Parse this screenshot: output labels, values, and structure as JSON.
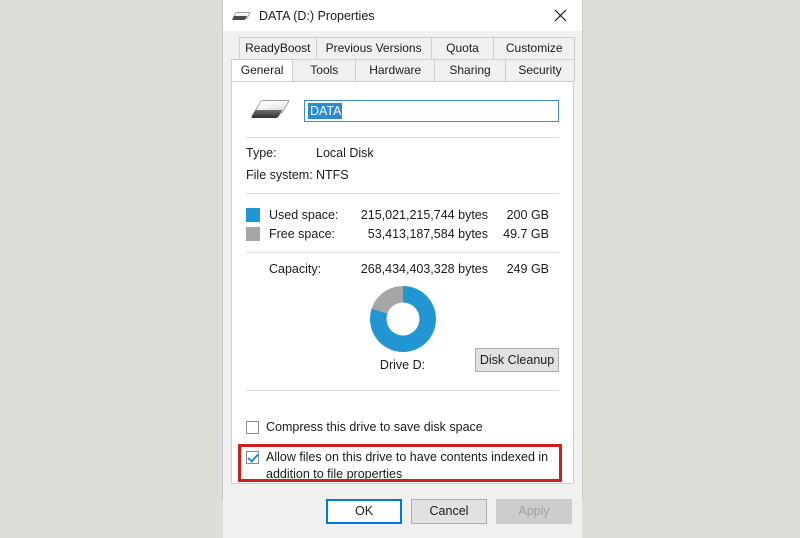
{
  "window": {
    "title": "DATA (D:) Properties",
    "icon": "hard-drive-icon",
    "close_label": "✕"
  },
  "tabs": {
    "row1": [
      {
        "label": "ReadyBoost",
        "active": false
      },
      {
        "label": "Previous Versions",
        "active": false
      },
      {
        "label": "Quota",
        "active": false
      },
      {
        "label": "Customize",
        "active": false
      }
    ],
    "row2": [
      {
        "label": "General",
        "active": true
      },
      {
        "label": "Tools",
        "active": false
      },
      {
        "label": "Hardware",
        "active": false
      },
      {
        "label": "Sharing",
        "active": false
      },
      {
        "label": "Security",
        "active": false
      }
    ]
  },
  "general": {
    "volume_name": "DATA",
    "type_label": "Type:",
    "type_value": "Local Disk",
    "filesystem_label": "File system:",
    "filesystem_value": "NTFS",
    "used": {
      "label": "Used space:",
      "bytes": "215,021,215,744 bytes",
      "size": "200 GB",
      "color": "#2196d3"
    },
    "free": {
      "label": "Free space:",
      "bytes": "53,413,187,584 bytes",
      "size": "49.7 GB",
      "color": "#a6a6a6"
    },
    "capacity": {
      "label": "Capacity:",
      "bytes": "268,434,403,328 bytes",
      "size": "249 GB"
    },
    "drive_label": "Drive D:",
    "disk_cleanup_label": "Disk Cleanup",
    "compress_checkbox": {
      "label": "Compress this drive to save disk space",
      "checked": false
    },
    "index_checkbox": {
      "label": "Allow files on this drive to have contents indexed in addition to file properties",
      "checked": true,
      "highlighted": true,
      "highlight_color": "#cc1f1f"
    }
  },
  "footer": {
    "ok_label": "OK",
    "cancel_label": "Cancel",
    "apply_label": "Apply",
    "apply_enabled": false
  },
  "chart_data": {
    "type": "pie",
    "title": "Drive D:",
    "categories": [
      "Used space",
      "Free space"
    ],
    "values": [
      215021215744,
      53413187584
    ],
    "percentages": [
      80.1,
      19.9
    ],
    "colors": [
      "#2196d3",
      "#a6a6a6"
    ],
    "labels": [
      "200 GB",
      "49.7 GB"
    ],
    "total": 268434403328,
    "donut": true,
    "legend": "left-list"
  }
}
